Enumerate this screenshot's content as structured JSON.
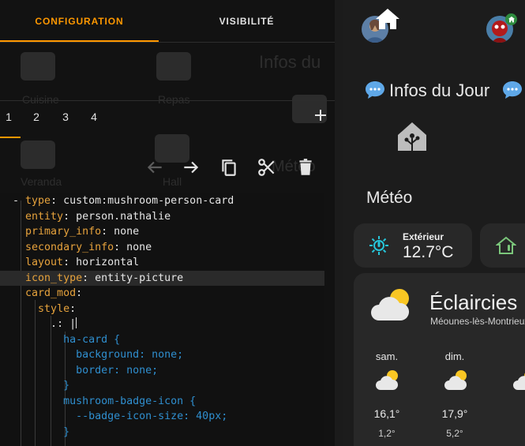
{
  "editor": {
    "tabs": {
      "configuration": "CONFIGURATION",
      "visibility": "VISIBILITÉ"
    },
    "background_ghost": {
      "tile1": "Cuisine",
      "tile2": "Repas",
      "tile3": "Veranda",
      "tile4": "Hall",
      "title": "Infos du",
      "meteo": "Météo"
    },
    "card_tabs": [
      "1",
      "2",
      "3",
      "4"
    ],
    "add_symbol": "+",
    "code_lines": [
      {
        "dash": "- ",
        "key": "type",
        "value": "custom:mushroom-person-card"
      },
      {
        "key": "entity",
        "value": "person.nathalie"
      },
      {
        "key": "primary_info",
        "value": "none"
      },
      {
        "key": "secondary_info",
        "value": "none"
      },
      {
        "key": "layout",
        "value": "horizontal"
      },
      {
        "key": "icon_type",
        "value": "entity-picture"
      },
      {
        "key": "card_mod",
        "value": ""
      },
      {
        "key": "style",
        "value": ""
      },
      {
        "key": ".",
        "value": "|"
      },
      {
        "css": "ha-card {"
      },
      {
        "css": "background: none;"
      },
      {
        "css": "border: none;"
      },
      {
        "css": "}"
      },
      {
        "css": "mushroom-badge-icon {"
      },
      {
        "css": "--badge-icon-size: 40px;"
      },
      {
        "css": "}"
      }
    ]
  },
  "dashboard": {
    "infos_title": "Infos du Jour",
    "meteo_title": "Météo",
    "outdoor": {
      "label": "Extérieur",
      "value": "12.7°C"
    },
    "weather": {
      "condition": "Éclaircies",
      "location": "Méounes-lès-Montrieux",
      "forecast": [
        {
          "day": "sam.",
          "high": "16,1°",
          "low": "1,2°"
        },
        {
          "day": "dim.",
          "high": "17,9°",
          "low": "5,2°"
        }
      ]
    }
  },
  "colors": {
    "accent": "#ff9800",
    "yaml_key": "#e6a23c",
    "css_code": "#2f8fcf",
    "teal_icon": "#26c6da",
    "green_icon": "#7bc67b"
  }
}
